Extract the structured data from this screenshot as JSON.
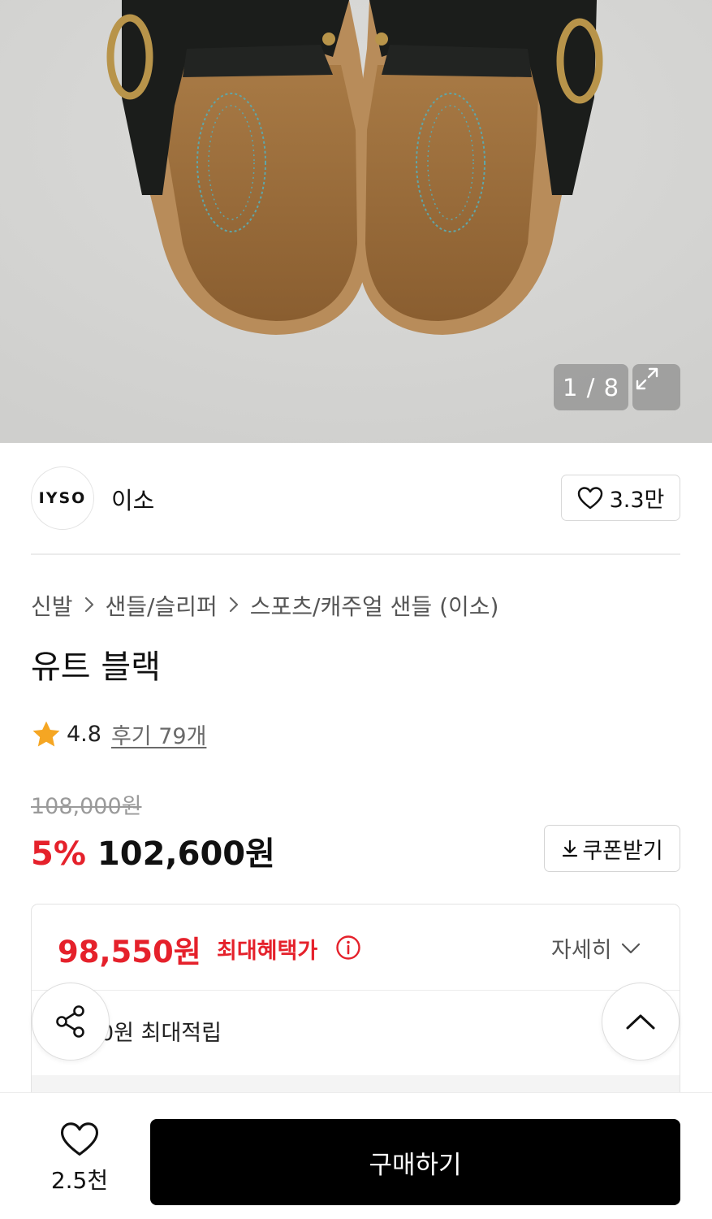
{
  "gallery": {
    "counter": "1 / 8",
    "image_alt": "product photo: black leather slip-on sandals with gold buckle, top view"
  },
  "brand": {
    "logo_text": "IYSO",
    "name": "이소",
    "like_count": "3.3만"
  },
  "breadcrumb": [
    "신발",
    "샌들/슬리퍼",
    "스포츠/캐주얼 샌들 (이소)"
  ],
  "product": {
    "title": "유트 블랙",
    "rating": "4.8",
    "reviews": "후기 79개"
  },
  "price": {
    "original": "108,000원",
    "discount_rate": "5%",
    "sale": "102,600원",
    "coupon_label": "쿠폰받기"
  },
  "benefit": {
    "max_price": "98,550원",
    "max_label": "최대혜택가",
    "detail_label": "자세히",
    "points_text": "0원 최대적립"
  },
  "bottom": {
    "wish_count": "2.5천",
    "buy_label": "구매하기"
  },
  "colors": {
    "accent_red": "#e5212b",
    "buy_button": "#000000",
    "rating_star": "#f5a623"
  }
}
